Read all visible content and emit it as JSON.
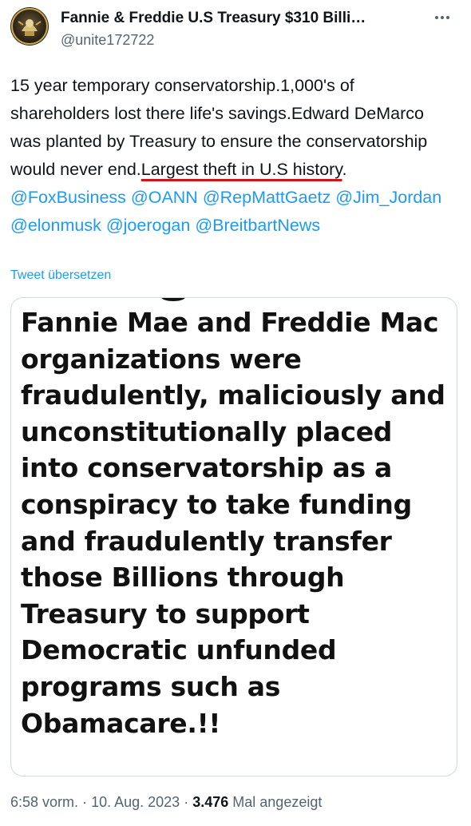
{
  "author": {
    "display_name": "Fannie & Freddie U.S Treasury $310 Billi…",
    "handle": "@unite172722"
  },
  "tweet": {
    "text_plain_1": "15 year temporary conservatorship.1,000's of shareholders lost there life's savings.Edward DeMarco was planted by Treasury to ensure the conservatorship would never end.",
    "text_highlight": "Largest theft in U.S history",
    "text_plain_2": ".",
    "mentions": [
      "@FoxBusiness",
      "@OANN",
      "@RepMattGaetz",
      "@Jim_Jordan",
      "@elonmusk",
      "@joerogan",
      "@BreitbartNews"
    ],
    "translate_label": "Tweet übersetzen"
  },
  "media": {
    "image_text": "Fannie Mae and Freddie Mac organizations were fraudulently, maliciously and unconstitutionally placed into conservatorship as a conspiracy to take funding and fraudulently transfer those Billions through Treasury to support Democratic unfunded programs such as Obamacare.!!"
  },
  "meta": {
    "time": "6:58 vorm.",
    "separator": "·",
    "date": "10. Aug. 2023",
    "separator2": "·",
    "views_count": "3.476",
    "views_label": "Mal angezeigt"
  },
  "colors": {
    "accent": "#1d9bf0",
    "underline": "#d0141c",
    "secondary_text": "#536471"
  },
  "icons": {
    "more": "more-horizontal-icon",
    "avatar": "avatar"
  }
}
